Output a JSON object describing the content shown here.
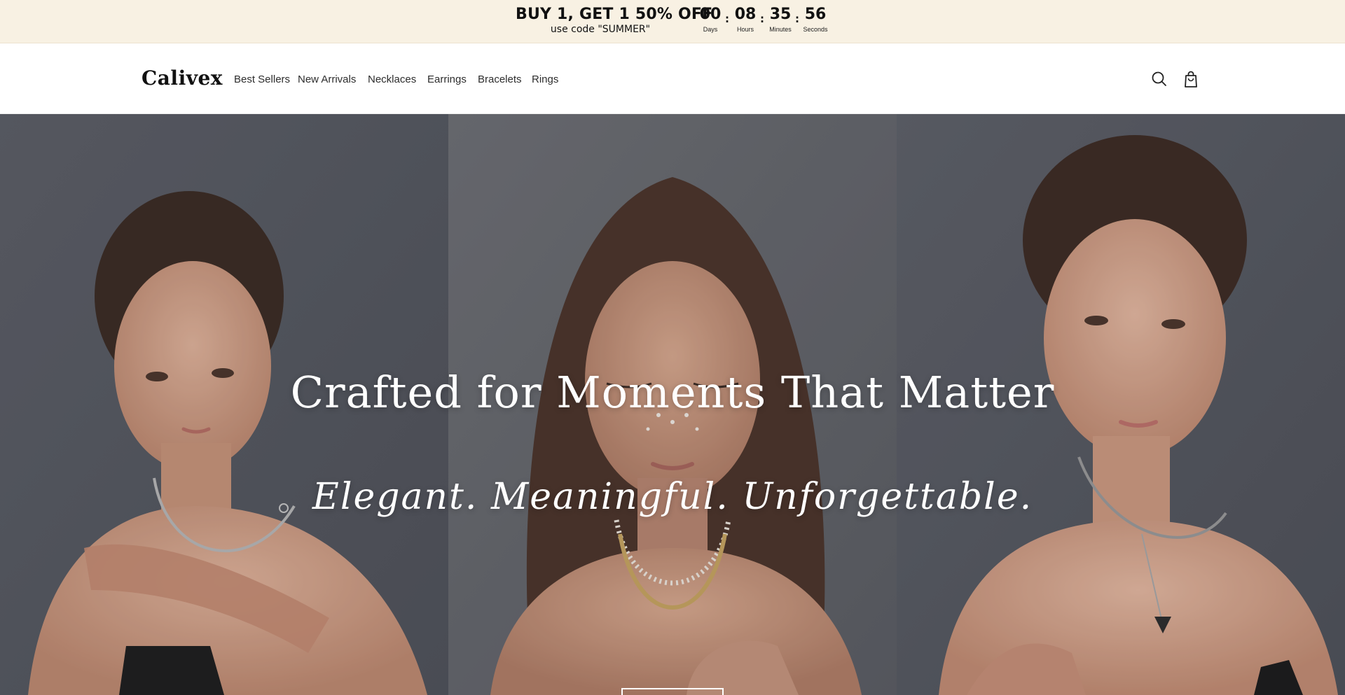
{
  "announcement": {
    "promo_title": "BUY 1, GET 1 50% OFF",
    "promo_code": "use code \"SUMMER\"",
    "countdown": [
      {
        "value": "00",
        "label": "Days"
      },
      {
        "value": "08",
        "label": "Hours"
      },
      {
        "value": "35",
        "label": "Minutes"
      },
      {
        "value": "56",
        "label": "Seconds"
      }
    ],
    "separator": ":",
    "background": "#f8f1e3"
  },
  "header": {
    "logo": "Calivex",
    "nav": [
      "Best Sellers",
      "New Arrivals",
      "Necklaces",
      "Earrings",
      "Bracelets",
      "Rings"
    ],
    "icons": [
      "search-icon",
      "shopping-bag-icon"
    ]
  },
  "hero": {
    "title": "Crafted for Moments That Matter",
    "subtitle": "Elegant. Meaningful. Unforgettable.",
    "background": "#5e6068"
  }
}
